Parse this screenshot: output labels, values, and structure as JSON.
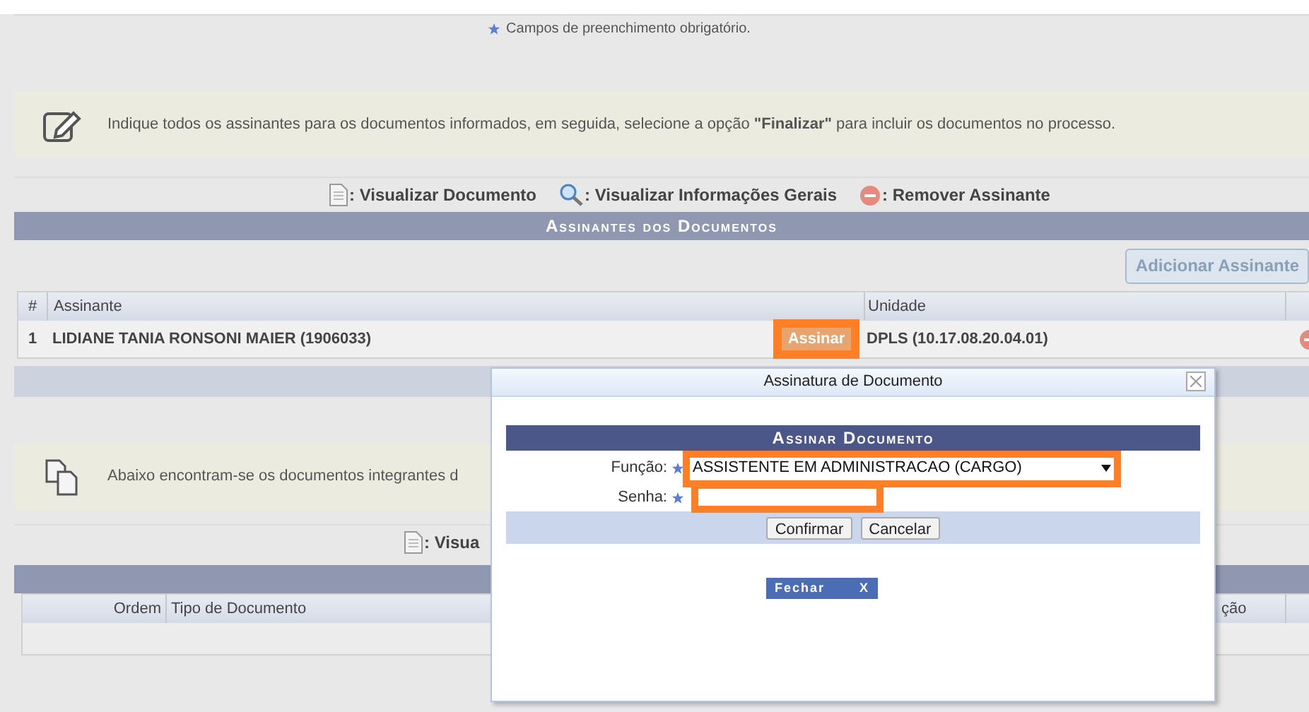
{
  "required_note": {
    "text": "Campos de preenchimento obrigatório."
  },
  "instruction": {
    "text": "Indique todos os assinantes para os documentos informados, em seguida, selecione a opção **\"Finalizar\"** para incluir os documentos no processo."
  },
  "legend": [
    {
      "kind": "document",
      "label": ": Visualizar Documento"
    },
    {
      "kind": "search",
      "label": ": Visualizar Informações Gerais"
    },
    {
      "kind": "remove",
      "label": ": Remover Assinante"
    }
  ],
  "signers": {
    "title": "Assinantes dos Documentos",
    "add_button": "Adicionar Assinante",
    "columns": [
      "#",
      "Assinante",
      "Unidade"
    ],
    "rows": [
      {
        "index": "1",
        "name": "LIDIANE TANIA RONSONI MAIER (1906033)",
        "sign_button": "Assinar",
        "highlighted": true,
        "unit": "DPLS (10.17.08.20.04.01)"
      }
    ]
  },
  "documents_note": {
    "text": "Abaixo encontram-se os documentos integrantes d"
  },
  "documents_legend": [
    {
      "kind": "document",
      "label": ": Visua"
    }
  ],
  "documents": {
    "columns": [
      "Ordem",
      "Tipo de Documento"
    ],
    "column_3": "ção"
  },
  "dialog": {
    "title": "Assinatura de Documento",
    "panel_title": "Assinar Documento",
    "fields": [
      {
        "label": "Função:",
        "kind": "select",
        "value": "ASSISTENTE EM ADMINISTRACAO (CARGO)",
        "required": true,
        "highlighted": true
      },
      {
        "label": "Senha:",
        "kind": "password",
        "required": true,
        "highlighted": true
      }
    ],
    "buttons": [
      "Confirmar",
      "Cancelar"
    ],
    "close_button": "Fechar",
    "close_glyph": "X"
  }
}
